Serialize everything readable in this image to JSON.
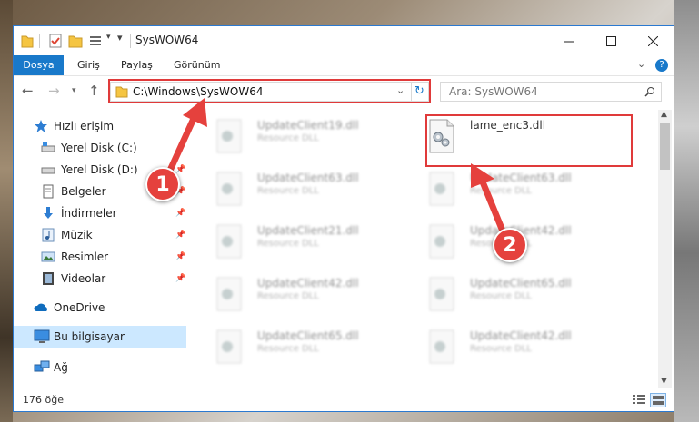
{
  "window": {
    "title": "SysWOW64"
  },
  "ribbon": {
    "tabs": [
      "Dosya",
      "Giriş",
      "Paylaş",
      "Görünüm"
    ]
  },
  "navigation": {
    "address": "C:\\Windows\\SysWOW64",
    "search_placeholder": "Ara: SysWOW64"
  },
  "sidebar": {
    "items": [
      {
        "label": "Hızlı erişim",
        "icon": "star-icon"
      },
      {
        "label": "Yerel Disk (C:)",
        "icon": "drive-icon"
      },
      {
        "label": "Yerel Disk (D:)",
        "icon": "drive-icon"
      },
      {
        "label": "Belgeler",
        "icon": "document-icon"
      },
      {
        "label": "İndirmeler",
        "icon": "download-icon"
      },
      {
        "label": "Müzik",
        "icon": "music-icon"
      },
      {
        "label": "Resimler",
        "icon": "pictures-icon"
      },
      {
        "label": "Videolar",
        "icon": "video-icon"
      },
      {
        "label": "OneDrive",
        "icon": "cloud-icon"
      },
      {
        "label": "Bu bilgisayar",
        "icon": "computer-icon"
      },
      {
        "label": "Ağ",
        "icon": "network-icon"
      }
    ]
  },
  "files": [
    {
      "name": "UpdateClient19.dll",
      "desc": "Resource DLL"
    },
    {
      "name": "lame_enc3.dll",
      "desc": ""
    },
    {
      "name": "UpdateClient63.dll",
      "desc": "Resource DLL"
    },
    {
      "name": "UpdateClient63.dll",
      "desc": "Resource DLL"
    },
    {
      "name": "UpdateClient21.dll",
      "desc": "Resource DLL"
    },
    {
      "name": "UpdateClient42.dll",
      "desc": "Resource DLL"
    },
    {
      "name": "UpdateClient42.dll",
      "desc": "Resource DLL"
    },
    {
      "name": "UpdateClient65.dll",
      "desc": "Resource DLL"
    },
    {
      "name": "UpdateClient65.dll",
      "desc": "Resource DLL"
    },
    {
      "name": "UpdateClient42.dll",
      "desc": "Resource DLL"
    }
  ],
  "status": {
    "count": "176 öğe"
  },
  "annotations": {
    "badge_1": "1",
    "badge_2": "2"
  },
  "colors": {
    "accent": "#1979ca",
    "highlight": "#e03a3a",
    "badge": "#e5413d",
    "selected": "#cce8ff"
  }
}
